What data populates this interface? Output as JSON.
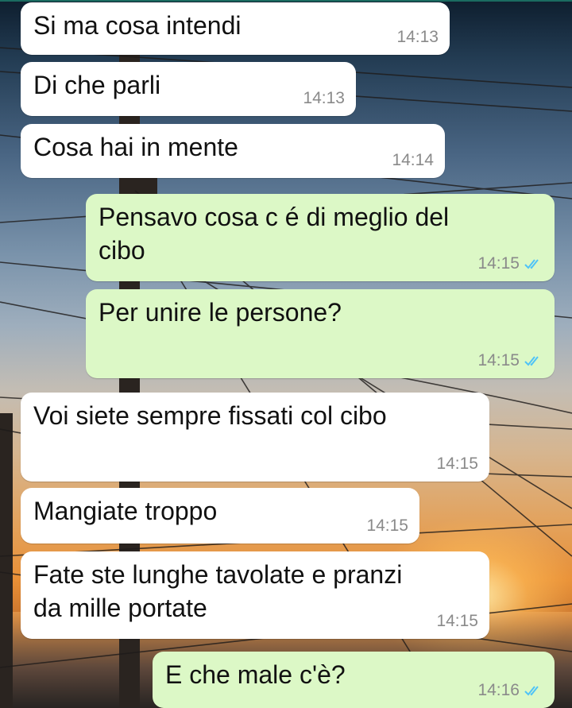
{
  "colors": {
    "incoming_bubble": "#ffffff",
    "outgoing_bubble": "#dcf8c6",
    "timestamp": "#8a8a8a",
    "read_ticks": "#4fc3f7"
  },
  "messages": [
    {
      "direction": "in",
      "text": "Si ma cosa intendi",
      "time": "14:13"
    },
    {
      "direction": "in",
      "text": "Di che parli",
      "time": "14:13"
    },
    {
      "direction": "in",
      "text": "Cosa hai in mente",
      "time": "14:14"
    },
    {
      "direction": "out",
      "text": "Pensavo cosa c é di meglio del\ncibo",
      "time": "14:15",
      "status_icon": "double-check-read-icon"
    },
    {
      "direction": "out",
      "text": "Per unire le persone?",
      "time": "14:15",
      "status_icon": "double-check-read-icon"
    },
    {
      "direction": "in",
      "text": "Voi siete sempre fissati col cibo",
      "time": "14:15"
    },
    {
      "direction": "in",
      "text": "Mangiate troppo",
      "time": "14:15"
    },
    {
      "direction": "in",
      "text": "Fate ste lunghe tavolate e pranzi\nda mille portate",
      "time": "14:15"
    },
    {
      "direction": "out",
      "text": "E che male c'è?",
      "time": "14:16",
      "status_icon": "double-check-read-icon"
    }
  ]
}
